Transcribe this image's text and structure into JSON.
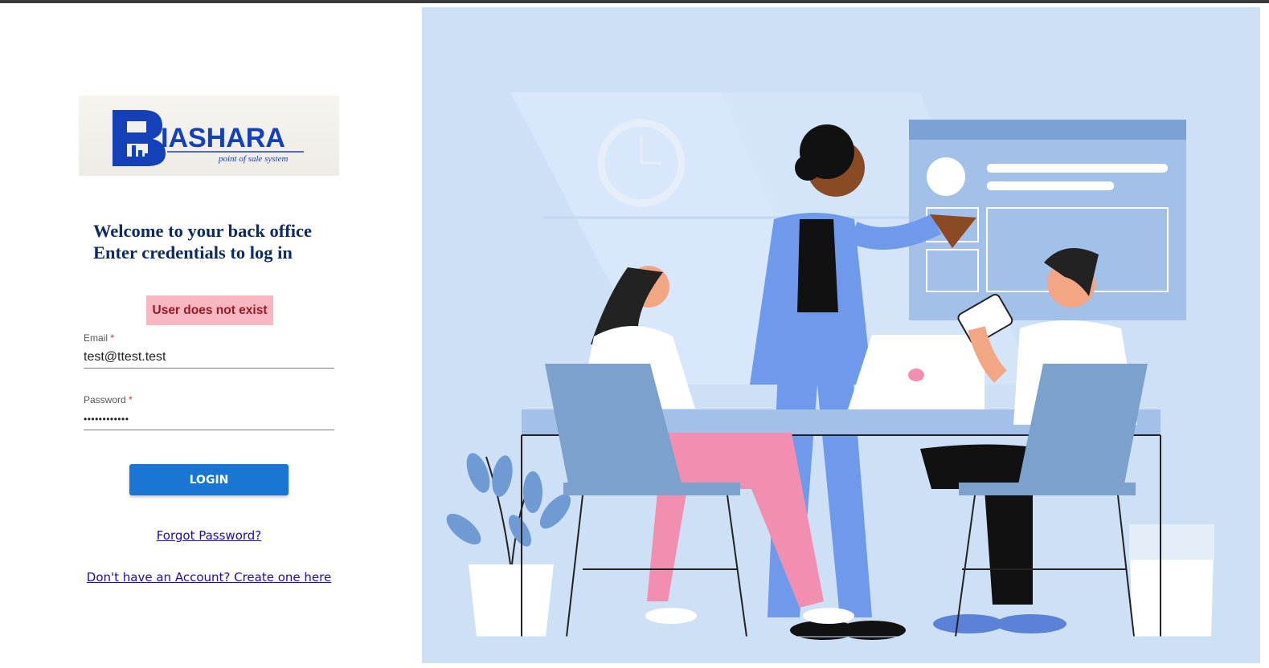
{
  "logo": {
    "brand_letter": "B",
    "brand_name": "IASHARA",
    "tagline": "point of sale system"
  },
  "welcome": {
    "line1": "Welcome to your back office",
    "line2": "Enter credentials to log in"
  },
  "error_message": "User does not exist",
  "form": {
    "email": {
      "label": "Email",
      "required_mark": "*",
      "value": "test@ttest.test"
    },
    "password": {
      "label": "Password",
      "required_mark": "*",
      "value": "••••••••••••"
    },
    "login_label": "LOGIN"
  },
  "links": {
    "forgot_password": "Forgot Password?",
    "create_account": "Don't have an Account? Create one here"
  },
  "illustration": {
    "icon": "team-meeting-illustration",
    "colors": {
      "background": "#cde0f6",
      "primary_blue": "#6f9aec",
      "pink": "#f28fb0",
      "chair_blue": "#7ba1cc"
    }
  }
}
